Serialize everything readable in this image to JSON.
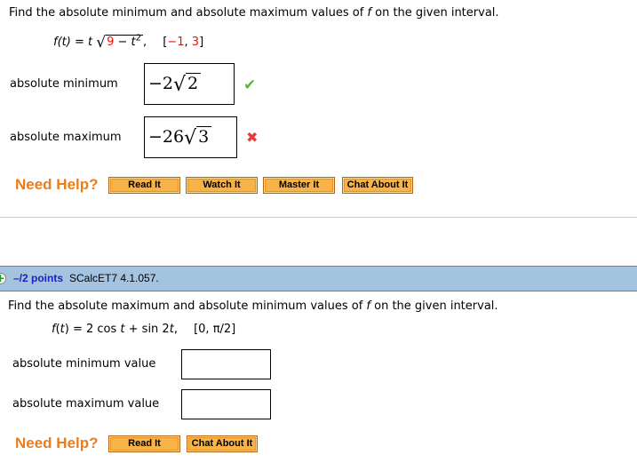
{
  "q1": {
    "prompt_pre": "Find the absolute minimum and absolute maximum values of ",
    "prompt_f": "f",
    "prompt_post": " on the given interval.",
    "func_lhs": "f(t) = t",
    "radicand_a": "9",
    "radicand_op": " − ",
    "radicand_b": "t",
    "radicand_exp": "2",
    "func_comma": ",",
    "interval_open": "[",
    "interval_lo": "−1",
    "interval_sep": ", ",
    "interval_hi": "3",
    "interval_close": "]",
    "answers": [
      {
        "label": "absolute minimum",
        "coef": "−2",
        "radicand": "2",
        "status": "correct",
        "status_icon": "✔"
      },
      {
        "label": "absolute maximum",
        "coef": "−26",
        "radicand": "3",
        "status": "incorrect",
        "status_icon": "✖"
      }
    ],
    "need_help": "Need Help?",
    "help_buttons": [
      "Read It",
      "Watch It",
      "Master It",
      "Chat About It"
    ]
  },
  "q2": {
    "expand_icon": "+",
    "points": "–/2 points",
    "id": "SCalcET7 4.1.057.",
    "prompt_pre": "Find the absolute maximum and absolute minimum values of ",
    "prompt_f": "f",
    "prompt_post": " on the given interval.",
    "func_f": "f",
    "func_open": "(",
    "func_t": "t",
    "func_mid": ") = 2 cos ",
    "func_t2": "t",
    "func_rest": " + sin 2",
    "func_t3": "t",
    "func_comma": ",",
    "interval": "[0, π/2]",
    "answers": [
      {
        "label": "absolute minimum value",
        "value": ""
      },
      {
        "label": "absolute maximum value",
        "value": ""
      }
    ],
    "need_help": "Need Help?",
    "help_buttons": [
      "Read It",
      "Chat About It"
    ]
  },
  "colors": {
    "need_help": "#ea7d1c",
    "button_bg": "#f7b347",
    "question_bar": "#a4c3df",
    "points": "#1f1fbf",
    "correct": "#5cb83a",
    "incorrect": "#ea3b3b",
    "interval_numbers": "#e8140c"
  }
}
